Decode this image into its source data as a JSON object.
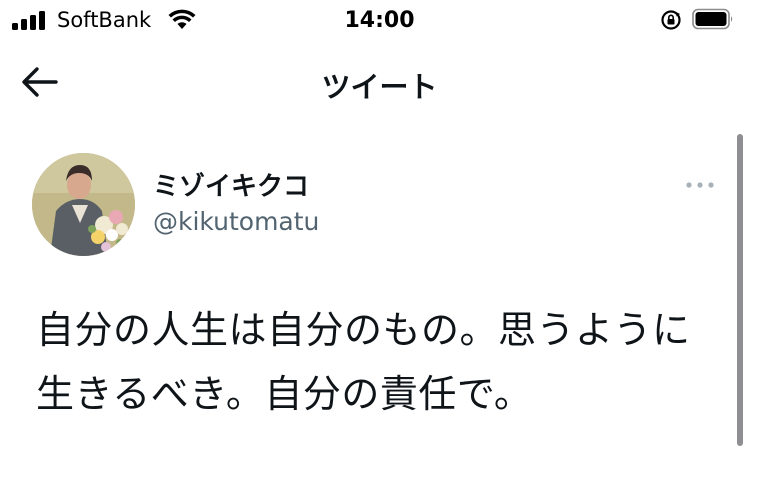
{
  "status_bar": {
    "carrier": "SoftBank",
    "time": "14:00",
    "icons": [
      "signal-icon",
      "wifi-icon",
      "orientation-lock-icon",
      "battery-icon"
    ]
  },
  "nav": {
    "title": "ツイート",
    "back_icon": "back-arrow-icon"
  },
  "tweet": {
    "author_name": "ミゾイキクコ",
    "handle": "@kikutomatu",
    "text": "自分の人生は自分のもの。思うように生きるべき。自分の責任で。",
    "more_icon": "more-options-icon"
  },
  "colors": {
    "text": "#0f1419",
    "secondary": "#536471",
    "more_icon": "#a7b1b9"
  }
}
